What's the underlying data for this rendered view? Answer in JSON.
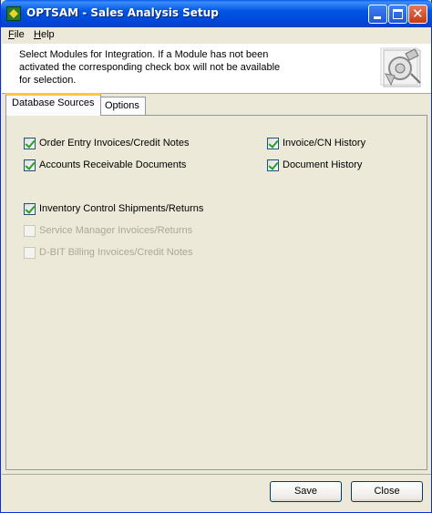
{
  "window": {
    "title": "OPTSAM - Sales Analysis Setup"
  },
  "menu": {
    "file": {
      "accel": "F",
      "rest": "ile"
    },
    "help": {
      "accel": "H",
      "rest": "elp"
    }
  },
  "header": {
    "line1": "Select Modules for Integration. If a Module has not been",
    "line2": "activated the corresponding check box will not be available",
    "line3": "for selection."
  },
  "tabs": {
    "database_sources": "Database Sources",
    "options": "Options"
  },
  "checkboxes": {
    "order_entry": {
      "label": "Order Entry Invoices/Credit Notes",
      "checked": true,
      "enabled": true
    },
    "invoice_cn_history": {
      "label": "Invoice/CN History",
      "checked": true,
      "enabled": true
    },
    "accounts_receivable": {
      "label": "Accounts Receivable Documents",
      "checked": true,
      "enabled": true
    },
    "document_history": {
      "label": "Document History",
      "checked": true,
      "enabled": true
    },
    "inventory_control": {
      "label": "Inventory Control Shipments/Returns",
      "checked": true,
      "enabled": true
    },
    "service_manager": {
      "label": "Service Manager Invoices/Returns",
      "checked": false,
      "enabled": false
    },
    "dbit_billing": {
      "label": "D-BIT Billing Invoices/Credit Notes",
      "checked": false,
      "enabled": false
    }
  },
  "buttons": {
    "save": "Save",
    "close": "Close"
  },
  "icons": {
    "app": "optsam-app-icon",
    "header_art": "setup-wizard-icon",
    "minimize": "minimize-icon",
    "maximize": "maximize-icon",
    "close": "close-icon"
  }
}
